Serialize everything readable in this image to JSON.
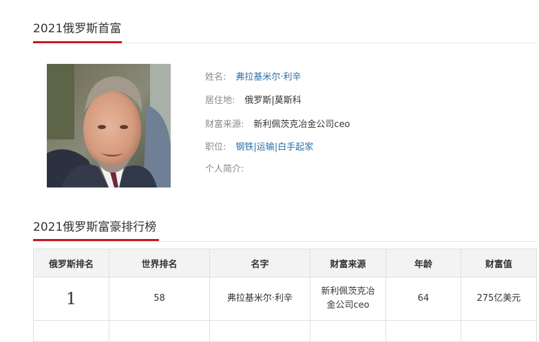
{
  "profile": {
    "title": "2021俄罗斯首富",
    "name_label": "姓名:",
    "name_value": "弗拉基米尔·利辛",
    "residence_label": "居住地:",
    "residence_value": "俄罗斯|莫斯科",
    "source_label": "财富来源:",
    "source_value": "新利佩茨克冶金公司ceo",
    "position_label": "职位:",
    "position_tags": [
      "钢铁",
      "运输",
      "白手起家"
    ],
    "bio_label": "个人简介:"
  },
  "ranking": {
    "title": "2021俄罗斯富豪排行榜",
    "columns": [
      "俄罗斯排名",
      "世界排名",
      "名字",
      "财富来源",
      "年龄",
      "财富值"
    ],
    "rows": [
      {
        "russia_rank": "1",
        "world_rank": "58",
        "name": "弗拉基米尔·利辛",
        "source": "新利佩茨克冶金公司ceo",
        "age": "64",
        "wealth": "275亿美元"
      }
    ]
  },
  "colors": {
    "accent": "#c81623",
    "link": "#2a6fa8"
  }
}
